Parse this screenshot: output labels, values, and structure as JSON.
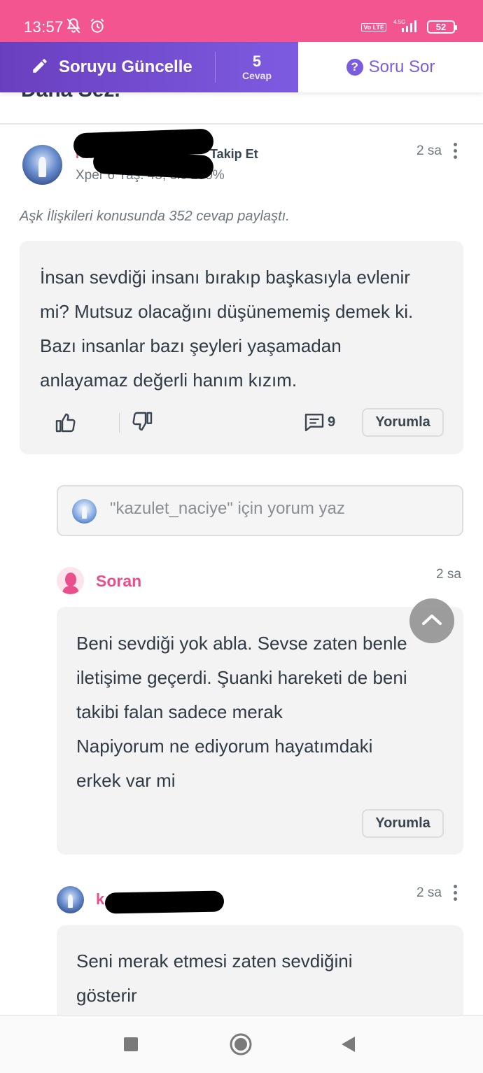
{
  "status_bar": {
    "time": "13:57",
    "network": "4.5G",
    "volte": "Vo LTE",
    "battery": "52"
  },
  "action_bar": {
    "update_label": "Soruyu Güncelle",
    "answers_count": "5",
    "answers_label": "Cevap",
    "ask_label": "Soru Sor"
  },
  "question_title_clipped": "Daha Sez.",
  "answer": {
    "author_name_visible": "Ka",
    "follow_label": "Takip Et",
    "meta": "Xper 6 Yaş: 45, elc 100%",
    "time": "2 sa",
    "expertise": "Aşk İlişkileri konusunda 352 cevap paylaştı.",
    "body": [
      "İnsan sevdiği insanı bırakıp başkasıyla evlenir",
      "mi? Mutsuz olacağını düşünememiş demek ki.",
      "Bazı insanlar bazı şeyleri yaşamadan",
      "anlayamaz değerli hanım kızım."
    ],
    "comment_count": "9",
    "comment_button": "Yorumla"
  },
  "comment_input": {
    "placeholder": "\"kazulet_naciye\" için yorum yaz"
  },
  "asker_comment": {
    "name": "Soran",
    "time": "2 sa",
    "body": [
      "Beni sevdiği yok abla. Sevse zaten benle",
      "iletişime geçerdi. Şuanki hareketi de beni",
      "takibi falan sadece merak",
      "Napiyorum ne ediyorum hayatımdaki",
      "erkek var mi"
    ],
    "comment_button": "Yorumla"
  },
  "reply_comment": {
    "author_name_visible": "k",
    "time": "2 sa",
    "body": [
      "Seni merak etmesi zaten sevdiğini",
      "gösterir"
    ]
  },
  "colors": {
    "status_bar": "#f2558f",
    "accent_purple": "#7b5ce0",
    "pink_name": "#e94f8c"
  }
}
